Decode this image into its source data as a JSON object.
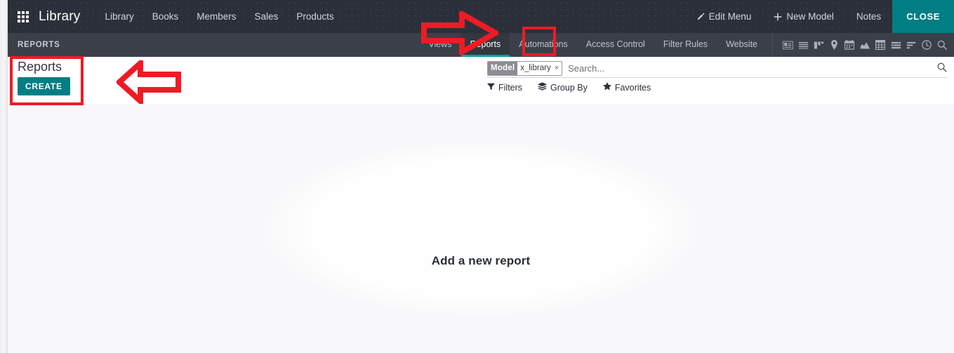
{
  "navbar": {
    "apps_icon": "apps-grid-icon",
    "brand": "Library",
    "menu_items": [
      {
        "label": "Library"
      },
      {
        "label": "Books"
      },
      {
        "label": "Members"
      },
      {
        "label": "Sales"
      },
      {
        "label": "Products"
      }
    ],
    "edit_menu": {
      "label": "Edit Menu",
      "icon": "pencil-icon"
    },
    "new_model": {
      "label": "New Model",
      "icon": "plus-icon"
    },
    "notes": {
      "label": "Notes"
    },
    "close": {
      "label": "CLOSE"
    }
  },
  "subbar": {
    "breadcrumb": "REPORTS",
    "tabs": [
      {
        "label": "Views",
        "active": false
      },
      {
        "label": "Reports",
        "active": true
      },
      {
        "label": "Automations",
        "active": false
      },
      {
        "label": "Access Control",
        "active": false
      },
      {
        "label": "Filter Rules",
        "active": false
      },
      {
        "label": "Website",
        "active": false
      }
    ],
    "view_icons": [
      {
        "name": "kanban-card-icon"
      },
      {
        "name": "list-icon"
      },
      {
        "name": "kanban-columns-icon"
      },
      {
        "name": "map-pin-icon"
      },
      {
        "name": "calendar-icon"
      },
      {
        "name": "graph-icon"
      },
      {
        "name": "pivot-icon"
      },
      {
        "name": "gantt-icon"
      },
      {
        "name": "bar-chart-icon"
      },
      {
        "name": "activity-clock-icon"
      },
      {
        "name": "search-icon"
      }
    ]
  },
  "control_panel": {
    "title": "Reports",
    "create_label": "CREATE",
    "search": {
      "facet_label": "Model",
      "facet_value": "x_library",
      "facet_remove": "×",
      "placeholder": "Search...",
      "value": "",
      "magnifier_icon": "search-icon"
    },
    "filters": [
      {
        "label": "Filters",
        "icon": "funnel-icon"
      },
      {
        "label": "Group By",
        "icon": "layers-icon"
      },
      {
        "label": "Favorites",
        "icon": "star-icon"
      }
    ]
  },
  "content": {
    "empty_message": "Add a new report"
  },
  "annotations": [
    {
      "name": "highlight-box-create-panel",
      "shape": "rectangle"
    },
    {
      "name": "highlight-box-reports-tab",
      "shape": "rectangle"
    },
    {
      "name": "arrow-pointing-right-to-reports-tab",
      "shape": "arrow-right"
    },
    {
      "name": "arrow-pointing-left-to-create-panel",
      "shape": "arrow-left"
    }
  ],
  "colors": {
    "navbar_bg": "#2b2f3a",
    "subbar_bg": "#3b3f4a",
    "accent_teal": "#017e84",
    "tab_underline": "#00a09d",
    "annotation_red": "#ee1b24",
    "content_bg": "#f8f8fa"
  }
}
